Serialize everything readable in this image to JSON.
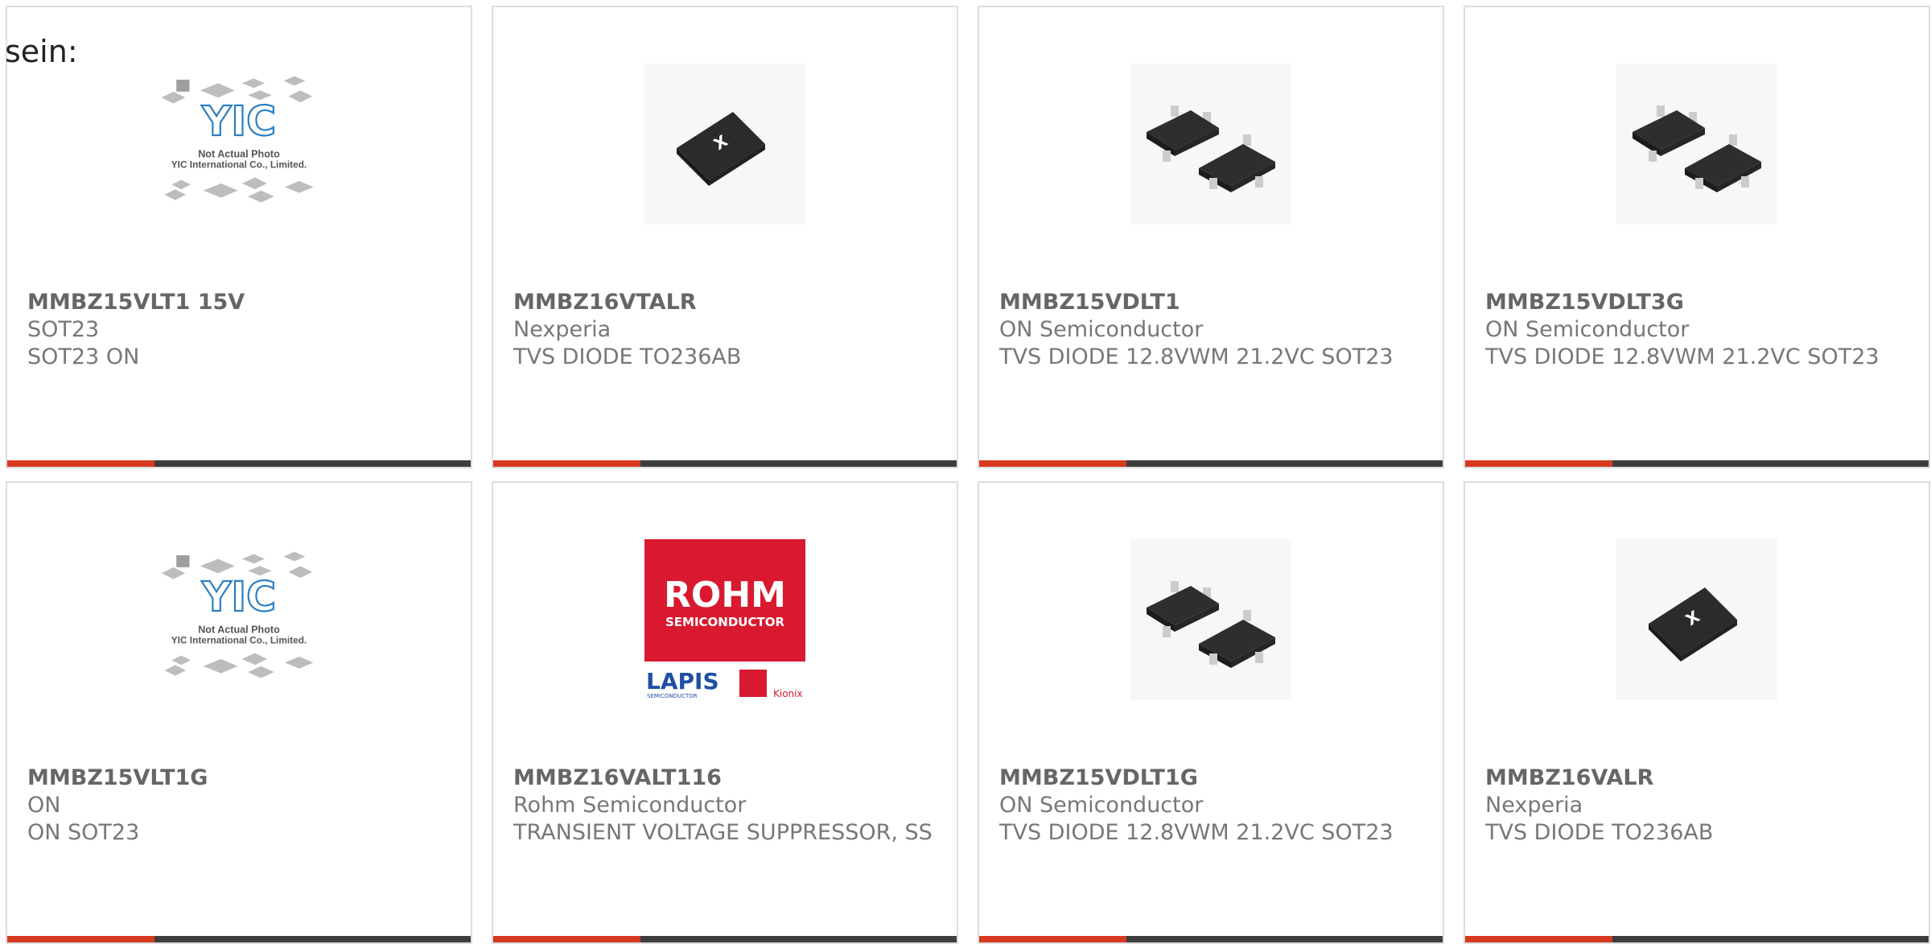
{
  "page": {
    "intro_text": "sein:"
  },
  "placeholder": {
    "caption_1": "Not Actual Photo",
    "caption_2": "YIC International Co., Limited.",
    "logo_text": "YIC"
  },
  "rohm_logo": {
    "brand": "ROHM",
    "sub": "SEMICONDUCTOR",
    "lapis": "LAPIS",
    "lapis_sub": "SEMICONDUCTOR",
    "kionix": "Kionix"
  },
  "colors": {
    "accent": "#d7391f",
    "bar_dark": "#3d3d3d",
    "card_border": "#dddddd"
  },
  "products": [
    {
      "title": "MMBZ15VLT1 15V",
      "line1": "SOT23",
      "line2": "SOT23 ON",
      "image": "not-actual-photo"
    },
    {
      "title": "MMBZ16VTALR",
      "line1": "Nexperia",
      "line2": "TVS DIODE TO236AB",
      "image": "sot23-chip-single"
    },
    {
      "title": "MMBZ15VDLT1",
      "line1": "ON Semiconductor",
      "line2": "TVS DIODE 12.8VWM 21.2VC SOT23",
      "image": "sot23-chip-pair"
    },
    {
      "title": "MMBZ15VDLT3G",
      "line1": "ON Semiconductor",
      "line2": "TVS DIODE 12.8VWM 21.2VC SOT23",
      "image": "sot23-chip-pair"
    },
    {
      "title": "MMBZ15VLT1G",
      "line1": "ON",
      "line2": "ON SOT23",
      "image": "not-actual-photo"
    },
    {
      "title": "MMBZ16VALT116",
      "line1": "Rohm Semiconductor",
      "line2": "TRANSIENT VOLTAGE SUPPRESSOR, SS",
      "image": "rohm-logo"
    },
    {
      "title": "MMBZ15VDLT1G",
      "line1": "ON Semiconductor",
      "line2": "TVS DIODE 12.8VWM 21.2VC SOT23",
      "image": "sot23-chip-pair"
    },
    {
      "title": "MMBZ16VALR",
      "line1": "Nexperia",
      "line2": "TVS DIODE TO236AB",
      "image": "sot23-chip-single"
    }
  ]
}
